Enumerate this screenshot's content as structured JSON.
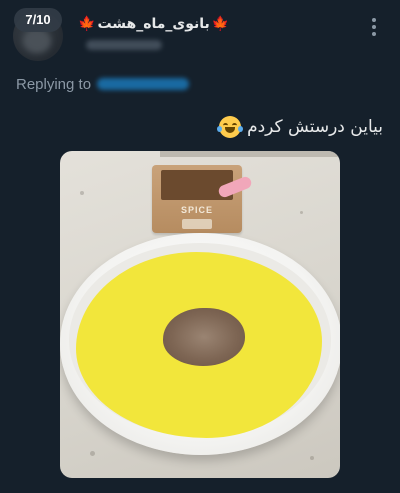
{
  "header": {
    "counter": "7/10",
    "display_name": "بانوی_ماه_هشت",
    "name_decoration": "🍁",
    "handle": "",
    "more_icon": "more-vertical-icon"
  },
  "reply": {
    "label": "Replying to",
    "handle": ""
  },
  "tweet": {
    "text": "بیاین درستش کردم",
    "emoji": "face-with-tears-of-joy-icon"
  },
  "photo": {
    "spice_label": "SPICE"
  },
  "colors": {
    "background": "#15202b",
    "text_primary": "#e7e9ea",
    "text_secondary": "#8b98a5",
    "link": "#1d9bf0",
    "overlay_yellow": "#f2e63b"
  }
}
